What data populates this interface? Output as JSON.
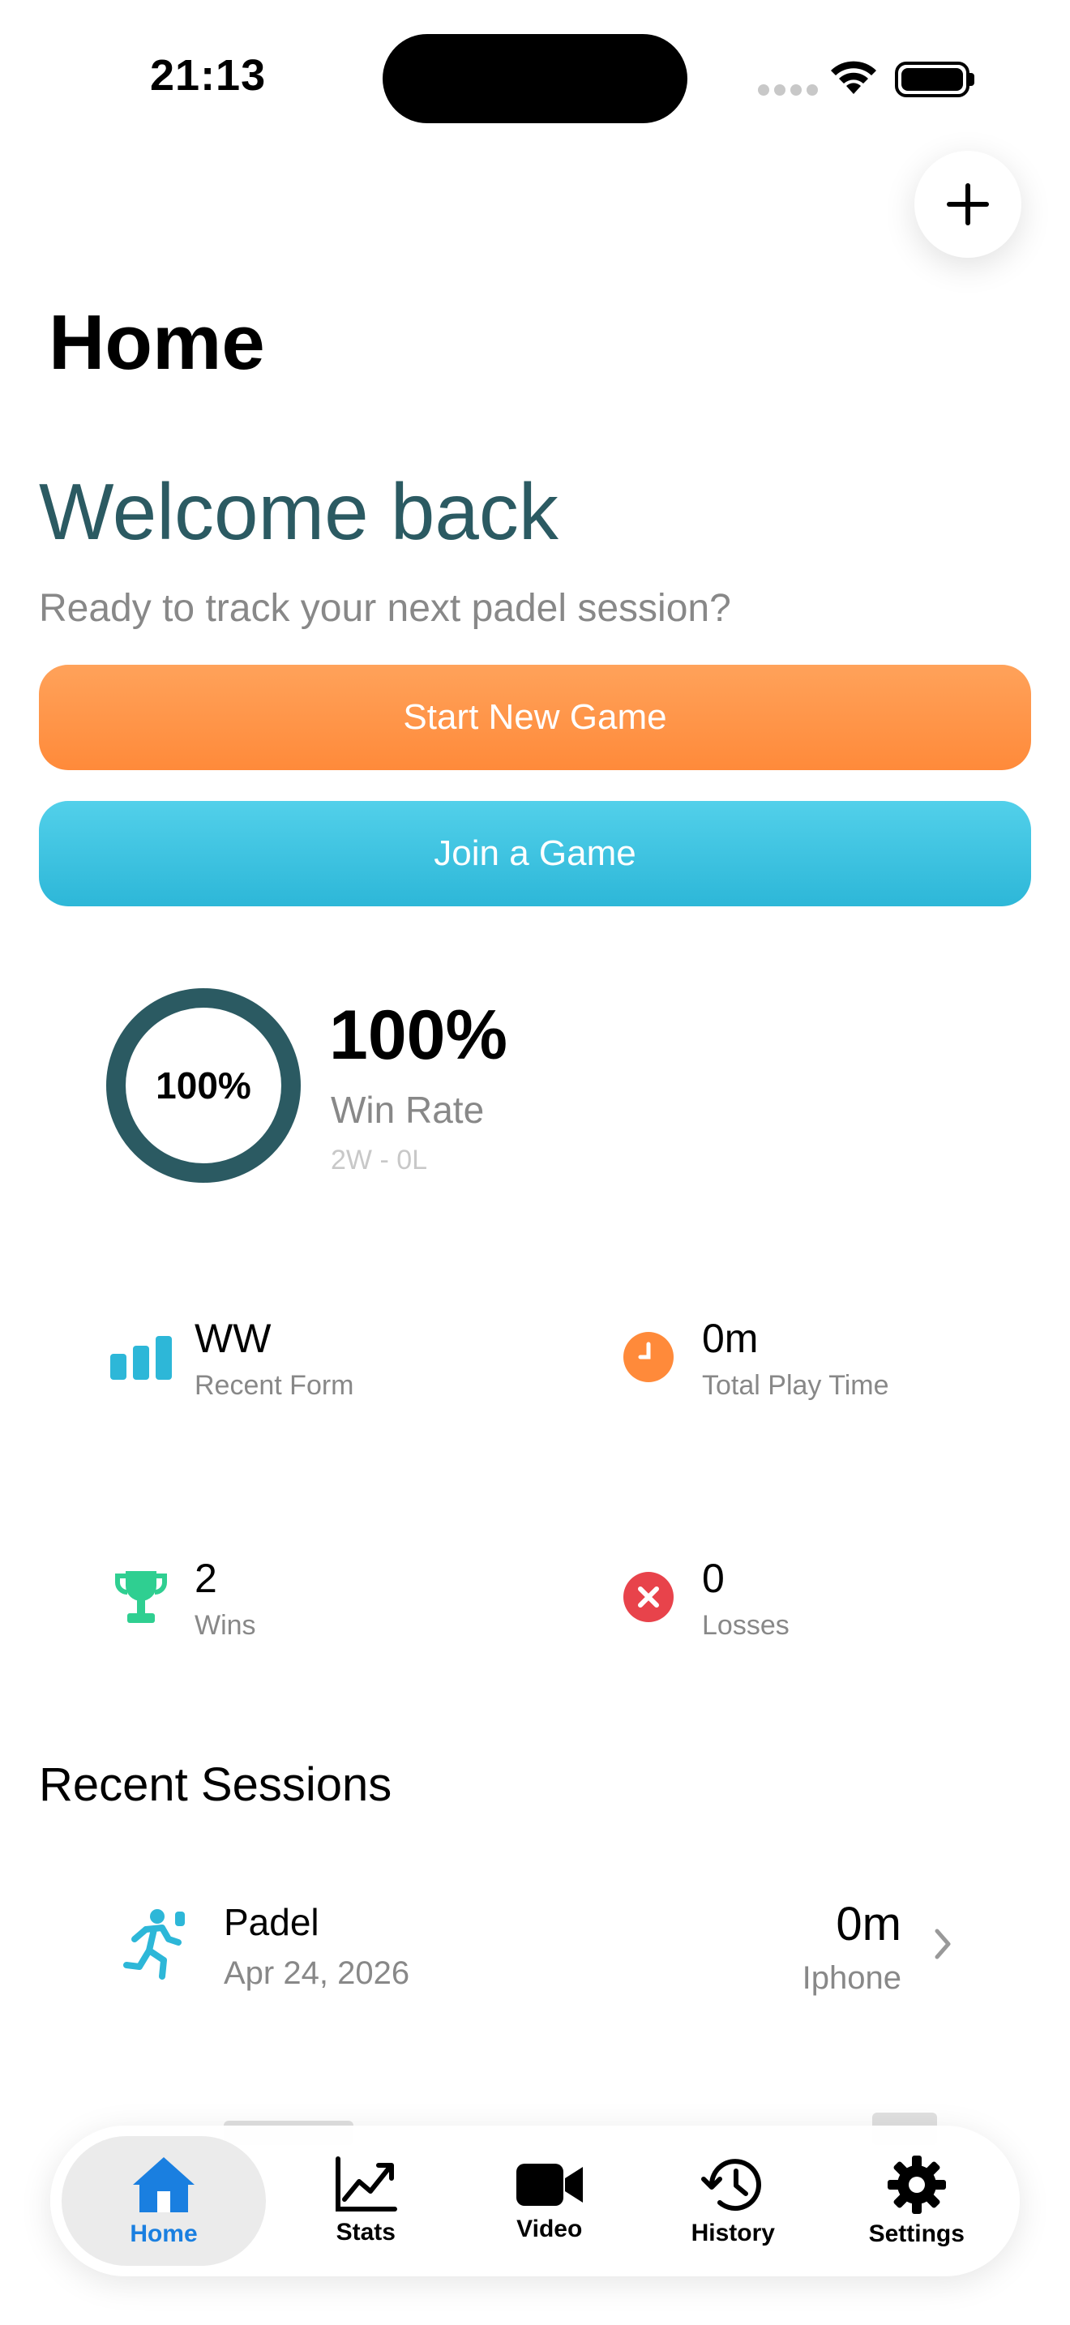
{
  "status_bar": {
    "time": "21:13"
  },
  "header": {
    "title": "Home"
  },
  "welcome": {
    "title": "Welcome back",
    "subtitle": "Ready to track your next padel session?"
  },
  "actions": {
    "start_label": "Start New Game",
    "join_label": "Join a Game"
  },
  "win_rate": {
    "ring_text": "100%",
    "value_text": "100%",
    "value": 1.0,
    "label": "Win Rate",
    "record": "2W - 0L"
  },
  "stats": [
    {
      "value": "WW",
      "label": "Recent Form",
      "icon": "bar-chart-icon",
      "color": "#2db7d8"
    },
    {
      "value": "0m",
      "label": "Total Play Time",
      "icon": "clock-icon",
      "color": "#ff8a3a"
    },
    {
      "value": "2",
      "label": "Wins",
      "icon": "trophy-icon",
      "color": "#2fcf91"
    },
    {
      "value": "0",
      "label": "Losses",
      "icon": "x-circle-icon",
      "color": "#e8434b"
    }
  ],
  "sessions": {
    "title": "Recent Sessions",
    "items": [
      {
        "name": "Padel",
        "date": "Apr 24, 2026",
        "duration": "0m",
        "source": "Iphone"
      }
    ]
  },
  "tabbar": {
    "items": [
      {
        "label": "Home",
        "icon": "house-icon",
        "active": true
      },
      {
        "label": "Stats",
        "icon": "chart-line-icon",
        "active": false
      },
      {
        "label": "Video",
        "icon": "video-camera-icon",
        "active": false
      },
      {
        "label": "History",
        "icon": "history-clock-icon",
        "active": false
      },
      {
        "label": "Settings",
        "icon": "gear-icon",
        "active": false
      }
    ]
  },
  "colors": {
    "accent_dark": "#2b5a62",
    "orange": "#ff8a3a",
    "cyan": "#2db7d8",
    "active_tab": "#1a7fe0"
  }
}
